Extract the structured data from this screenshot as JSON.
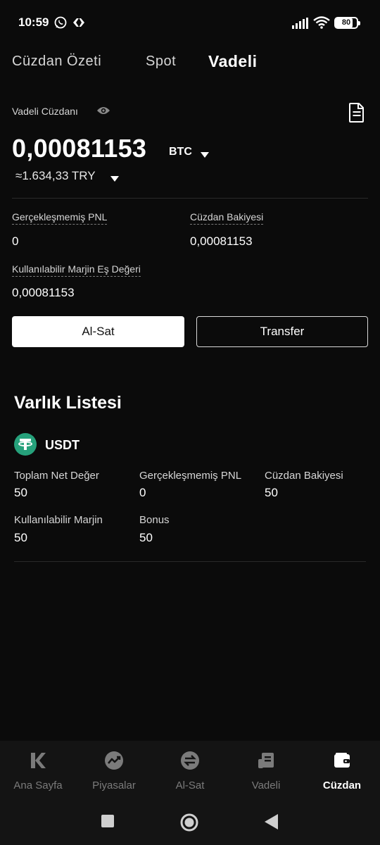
{
  "status_bar": {
    "time": "10:59",
    "battery": "80",
    "battery_level": 0.8
  },
  "tabs": [
    {
      "label": "Cüzdan Özeti",
      "active": false
    },
    {
      "label": "Spot",
      "active": false
    },
    {
      "label": "Vadeli",
      "active": true
    }
  ],
  "wallet": {
    "label": "Vadeli Cüzdanı",
    "balance": "0,00081153",
    "unit": "BTC",
    "fiat": "≈1.634,33 TRY"
  },
  "stats": {
    "unrealized_pnl": {
      "label": "Gerçekleşmemiş PNL",
      "value": "0"
    },
    "wallet_balance": {
      "label": "Cüzdan Bakiyesi",
      "value": "0,00081153"
    },
    "available_margin": {
      "label": "Kullanılabilir Marjin Eş Değeri",
      "value": "0,00081153"
    }
  },
  "buttons": {
    "trade": "Al-Sat",
    "transfer": "Transfer"
  },
  "assets": {
    "title": "Varlık Listesi",
    "items": [
      {
        "name": "USDT",
        "fields": [
          {
            "label": "Toplam Net Değer",
            "value": "50"
          },
          {
            "label": "Gerçekleşmemiş PNL",
            "value": "0"
          },
          {
            "label": "Cüzdan Bakiyesi",
            "value": "50"
          },
          {
            "label": "Kullanılabilir Marjin",
            "value": "50"
          },
          {
            "label": "Bonus",
            "value": "50"
          }
        ]
      }
    ]
  },
  "bottom_nav": [
    {
      "label": "Ana Sayfa",
      "icon": "home-k-icon",
      "active": false
    },
    {
      "label": "Piyasalar",
      "icon": "markets-icon",
      "active": false
    },
    {
      "label": "Al-Sat",
      "icon": "trade-icon",
      "active": false
    },
    {
      "label": "Vadeli",
      "icon": "futures-icon",
      "active": false
    },
    {
      "label": "Cüzdan",
      "icon": "wallet-icon",
      "active": true
    }
  ],
  "colors": {
    "background": "#0b0b0b",
    "usdt": "#26a17b",
    "accent": "#ffffff"
  }
}
